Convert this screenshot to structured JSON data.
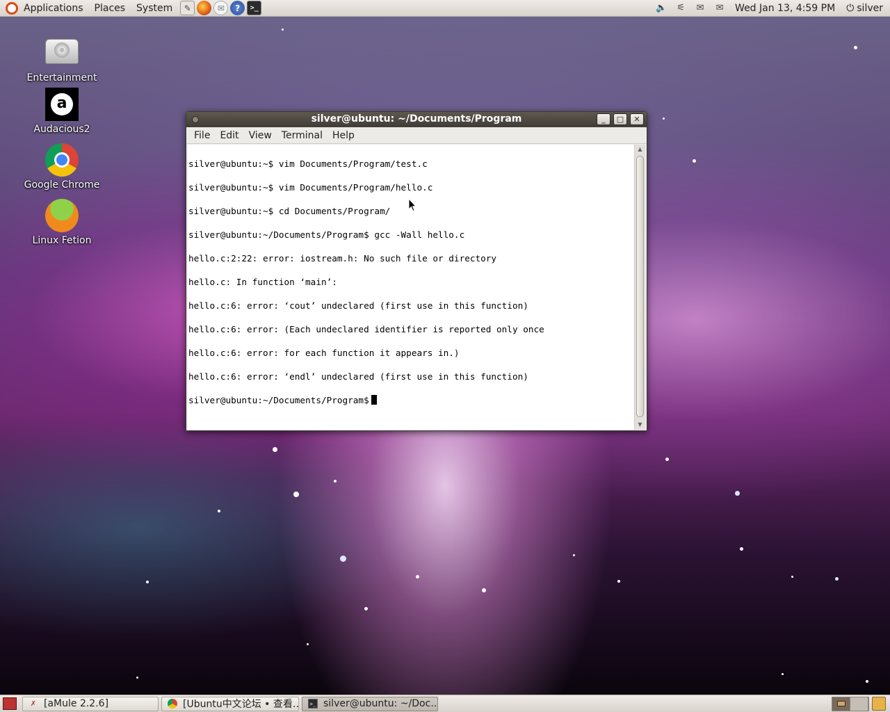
{
  "top_panel": {
    "menus": [
      "Applications",
      "Places",
      "System"
    ],
    "launchers": [
      "text-editor-icon",
      "firefox-icon",
      "mail-icon",
      "help-icon",
      "terminal-icon"
    ],
    "clock": "Wed Jan 13,  4:59 PM",
    "user": "silver"
  },
  "desktop_icons": [
    {
      "label": "Entertainment",
      "icon": "hard-drive-icon"
    },
    {
      "label": "Audacious2",
      "icon": "audacious-icon"
    },
    {
      "label": "Google Chrome",
      "icon": "chrome-icon"
    },
    {
      "label": "Linux Fetion",
      "icon": "fetion-icon"
    }
  ],
  "terminal": {
    "title": "silver@ubuntu: ~/Documents/Program",
    "menu": [
      "File",
      "Edit",
      "View",
      "Terminal",
      "Help"
    ],
    "lines": [
      "silver@ubuntu:~$ vim Documents/Program/test.c",
      "silver@ubuntu:~$ vim Documents/Program/hello.c",
      "silver@ubuntu:~$ cd Documents/Program/",
      "silver@ubuntu:~/Documents/Program$ gcc -Wall hello.c",
      "hello.c:2:22: error: iostream.h: No such file or directory",
      "hello.c: In function ‘main’:",
      "hello.c:6: error: ‘cout’ undeclared (first use in this function)",
      "hello.c:6: error: (Each undeclared identifier is reported only once",
      "hello.c:6: error: for each function it appears in.)",
      "hello.c:6: error: ‘endl’ undeclared (first use in this function)"
    ],
    "prompt": "silver@ubuntu:~/Documents/Program$"
  },
  "taskbar": {
    "tasks": [
      {
        "label": "[aMule 2.2.6]",
        "icon": "amule-icon"
      },
      {
        "label": "[Ubuntu中文论坛 • 查看…",
        "icon": "chrome-icon"
      },
      {
        "label": "silver@ubuntu: ~/Doc…",
        "icon": "terminal-icon"
      }
    ]
  },
  "colors": {
    "panel": "#dcd7d0",
    "titlebar": "#4a453f",
    "ubuntu_orange": "#dd4814"
  }
}
